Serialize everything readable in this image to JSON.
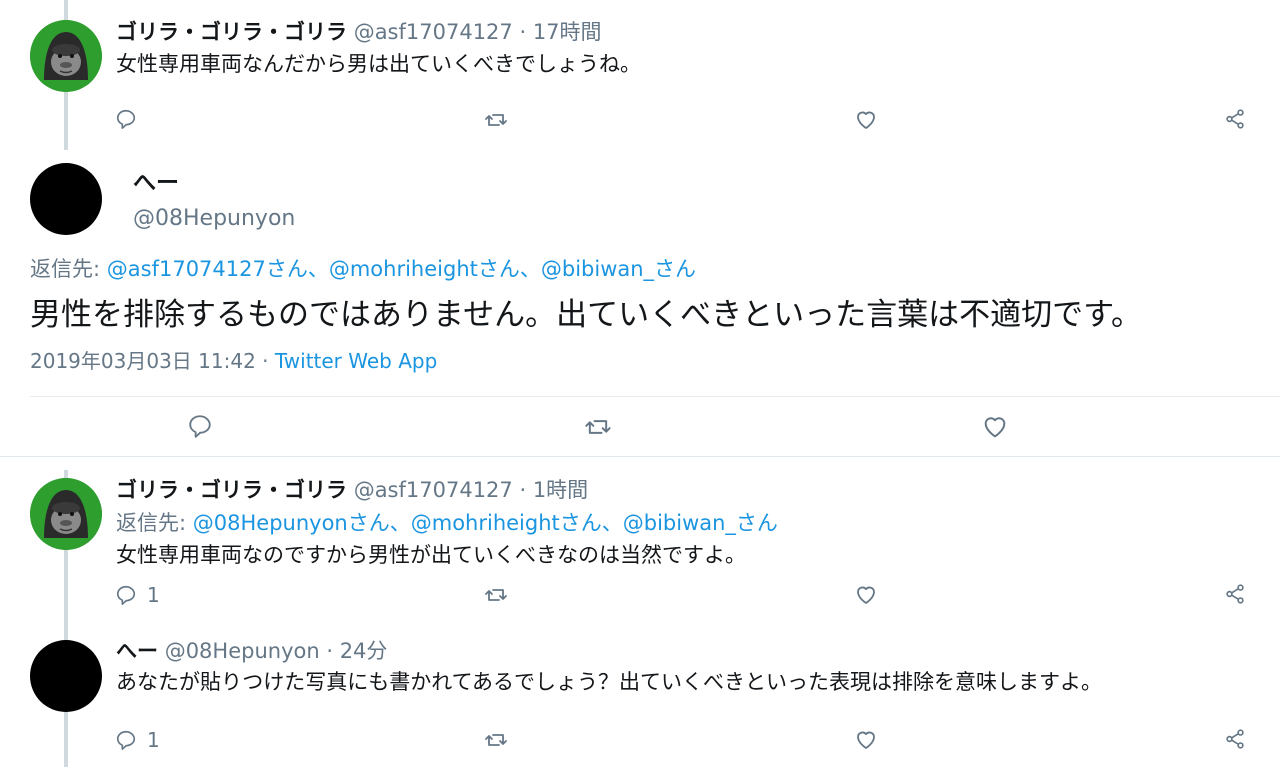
{
  "tweet1": {
    "name": "ゴリラ・ゴリラ・ゴリラ",
    "handle": "@asf17074127",
    "time": "· 17時間",
    "text": "女性専用車両なんだから男は出ていくべきでしょうね。"
  },
  "focus": {
    "name": "へー",
    "handle": "@08Hepunyon",
    "reply_prefix": "返信先:",
    "reply_to": "@asf17074127さん、@mohriheightさん、@bibiwan_さん",
    "text": "男性を排除するものではありません。出ていくべきといった言葉は不適切です。",
    "date": "2019年03月03日 11:42 ·",
    "source": "Twitter Web App"
  },
  "tweet3": {
    "name": "ゴリラ・ゴリラ・ゴリラ",
    "handle": "@asf17074127",
    "time": "· 1時間",
    "reply_prefix": "返信先:",
    "reply_to": "@08Hepunyonさん、@mohriheightさん、@bibiwan_さん",
    "text": "女性専用車両なのですから男性が出ていくべきなのは当然ですよ。",
    "reply_count": "1"
  },
  "tweet4": {
    "name": "へー",
    "handle": "@08Hepunyon",
    "time": "· 24分",
    "text": "あなたが貼りつけた写真にも書かれてあるでしょう？出ていくべきといった表現は排除を意味しますよ。",
    "reply_count": "1"
  },
  "icons": {
    "reply": "reply-icon",
    "retweet": "retweet-icon",
    "like": "like-icon",
    "share": "share-icon"
  },
  "colors": {
    "link": "#1b95e0",
    "muted": "#657786",
    "gorilla_bg": "#2e9e2e",
    "thread_line": "#cfd9de"
  }
}
